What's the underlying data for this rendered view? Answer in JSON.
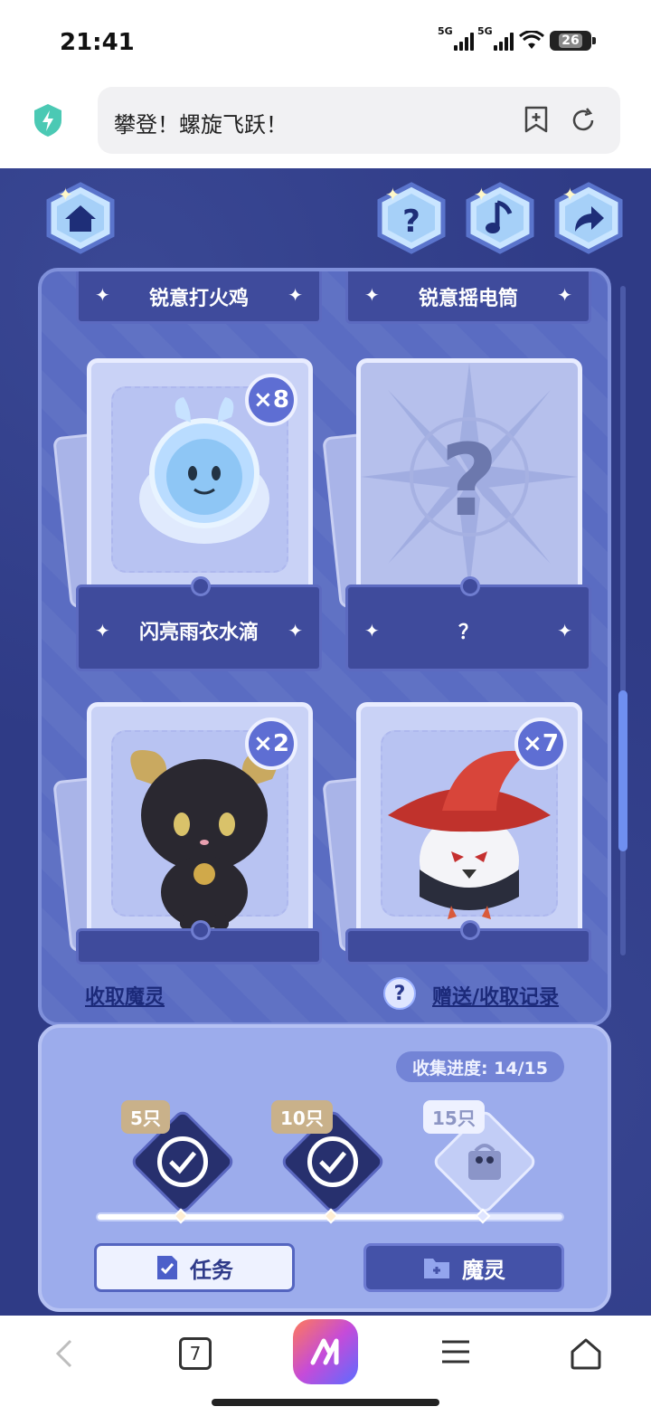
{
  "status_bar": {
    "time": "21:41",
    "signal_1": "5G",
    "signal_2": "5G",
    "battery": "26"
  },
  "browser": {
    "page_title": "攀登！螺旋飞跃！",
    "tab_count": "7"
  },
  "game": {
    "top_labels": [
      "锐意打火鸡",
      "锐意摇电筒"
    ],
    "cards": [
      {
        "name": "闪亮雨衣水滴",
        "count": "×8",
        "unlocked": true
      },
      {
        "name": "？",
        "count": "",
        "unlocked": false
      },
      {
        "name": "",
        "count": "×2",
        "unlocked": true
      },
      {
        "name": "",
        "count": "×7",
        "unlocked": true
      }
    ],
    "collect_link": "收取魔灵",
    "help_symbol": "?",
    "record_link": "赠送/收取记录",
    "progress_label": "收集进度: 14/15",
    "progress_fraction": 0.833,
    "milestones": [
      {
        "label": "5只",
        "done": true
      },
      {
        "label": "10只",
        "done": true
      },
      {
        "label": "15只",
        "done": false
      }
    ],
    "task_button": "任务",
    "spirit_button": "魔灵"
  },
  "colors": {
    "game_bg": "#2f3b86",
    "panel": "#5a6cc2",
    "accent": "#5e6ed3"
  }
}
